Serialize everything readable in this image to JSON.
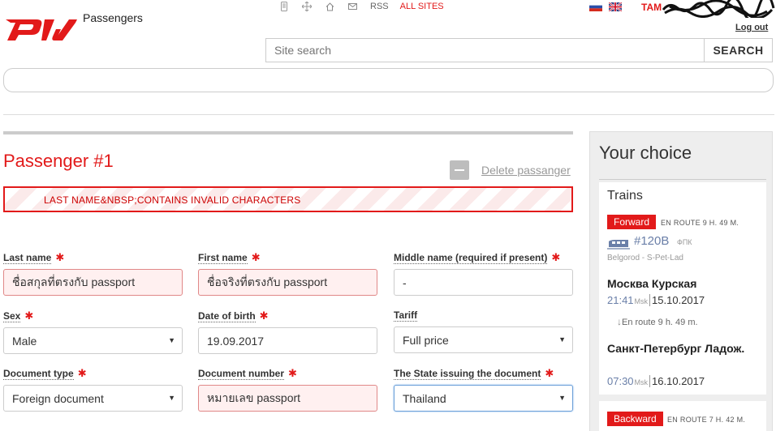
{
  "header": {
    "site_name": "Passengers",
    "nav": {
      "rss": "RSS",
      "all_sites": "ALL SITES"
    },
    "user_name": "TAM",
    "logout": "Log out",
    "icons": [
      "mobile-icon",
      "sitemap-icon",
      "home-icon",
      "mail-icon"
    ],
    "brand_color": "#e21a1a"
  },
  "search": {
    "placeholder": "Site search",
    "button": "SEARCH"
  },
  "passenger": {
    "title": "Passenger #1",
    "delete_label": "Delete passanger",
    "error": "LAST NAME&NBSP;CONTAINS INVALID CHARACTERS",
    "fields": {
      "last_name": {
        "label": "Last name",
        "value": "ชื่อสกุลที่ตรงกับ passport"
      },
      "first_name": {
        "label": "First name",
        "value": "ชื่อจริงที่ตรงกับ passport"
      },
      "middle_name": {
        "label": "Middle name (required if present)",
        "value": "-"
      },
      "sex": {
        "label": "Sex",
        "value": "Male"
      },
      "dob": {
        "label": "Date of birth",
        "value": "19.09.2017"
      },
      "tariff": {
        "label": "Tariff",
        "value": "Full price"
      },
      "doc_type": {
        "label": "Document type",
        "value": "Foreign document"
      },
      "doc_number": {
        "label": "Document number",
        "value": "หมายเลข passport"
      },
      "state": {
        "label": "The State issuing the document",
        "value": "Thailand"
      }
    }
  },
  "choice": {
    "title": "Your choice",
    "trains_label": "Trains",
    "forward": {
      "badge": "Forward",
      "route_time": "EN ROUTE  9 H. 49 M.",
      "train_number": "#120B",
      "company": "ФПК",
      "route": "Belgorod - S-Pet-Lad",
      "from_station": "Москва Курская",
      "dep_time": "21:41",
      "dep_tz": "Msk",
      "dep_date": "15.10.2017",
      "en_route": "En route  9 h. 49 m.",
      "to_station": "Санкт-Петербург Ладож.",
      "arr_time": "07:30",
      "arr_tz": "Msk",
      "arr_date": "16.10.2017"
    },
    "backward": {
      "badge": "Backward",
      "route_time": "EN ROUTE  7 H. 42 M."
    }
  }
}
